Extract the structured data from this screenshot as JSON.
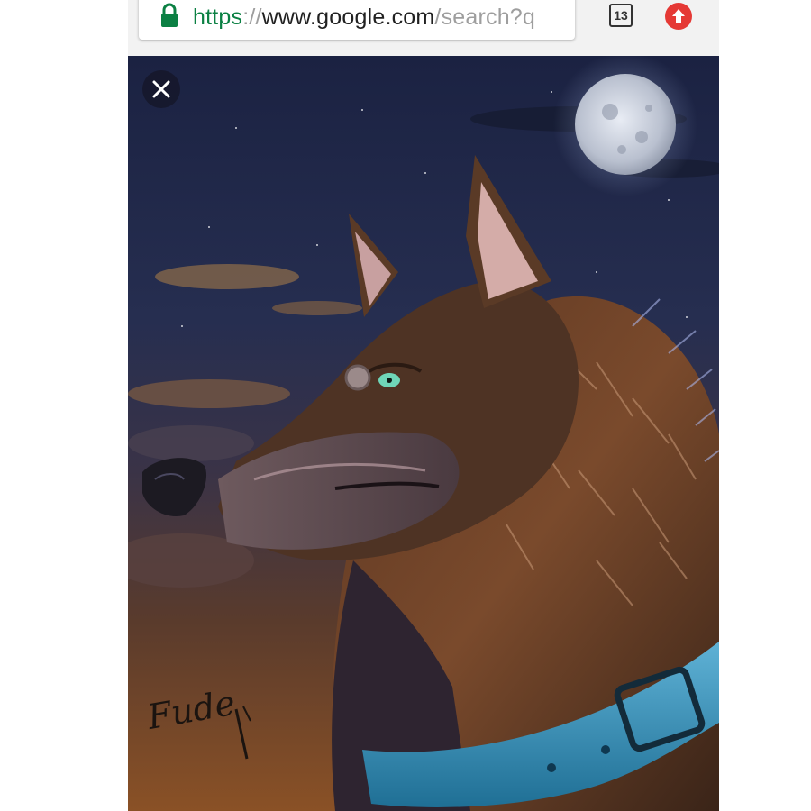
{
  "browser": {
    "url": {
      "scheme": "https",
      "separator": "://",
      "host": "www.google.com",
      "path": "/search?q"
    },
    "tab_count": "13",
    "accent_secure": "#0b8043",
    "update_button_color": "#e53935"
  },
  "image_viewer": {
    "close_icon": "close-icon",
    "subject": "wolf-artwork",
    "signature": "Fude"
  }
}
